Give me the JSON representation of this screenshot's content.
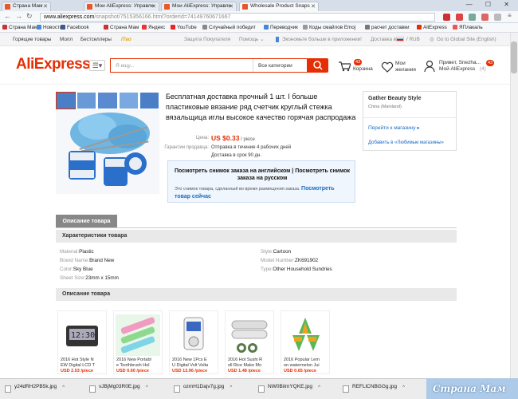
{
  "browser": {
    "tabs": [
      {
        "label": "Страна Мам",
        "active": false
      },
      {
        "label": "Мои AliExpress: Управле",
        "active": false
      },
      {
        "label": "Мои AliExpress: Управле",
        "active": false
      },
      {
        "label": "Wholesale Product Snaps",
        "active": true
      }
    ],
    "url_host": "www.aliexpress.com",
    "url_path": "/snapshot/7515356166.html?orderId=74149760671667",
    "bookmarks": [
      "Страна Мам",
      "Новости",
      "Facebook",
      "Страна Мам",
      "Яндекс",
      "YouTube",
      "Случайный победит",
      "Переводчик",
      "Коды смайлов Emoj",
      "расчет доставки",
      "AliExpress",
      "ЯПлакаль"
    ],
    "window_controls": "— ☐ ✕"
  },
  "topnav": {
    "hot_items": "Горящие товары",
    "mall": "Молл",
    "bestsellers": "Бестселлеры",
    "itao": "iTao",
    "protection": "Защита Покупателя",
    "help": "Помощь ⌄",
    "app": "Экономьте больше в приложении!",
    "delivery": "Доставка в",
    "currency": "/ RUB",
    "global": "Go to Global Site (English)"
  },
  "header": {
    "logo_main": "AliExpress",
    "search_placeholder": "Я ищу...",
    "category": "Все категории",
    "cart_label": "Корзина",
    "cart_count": "43",
    "wish_line1": "Мои",
    "wish_line2": "желания",
    "greeting": "Привет, Snezha...",
    "account": "Мой AliExpress",
    "account_count": "(4)",
    "msg_count": "43"
  },
  "product": {
    "title": "Бесплатная доставка прочный 1 шт. I больше пластиковые вязание ряд счетчик круглый стежка вязальщица иглы высокое качество горячая распродажа",
    "price_label": "Цена:",
    "price": "US $0.33",
    "price_unit": "/ piece",
    "guarantee_label": "Гарантии продавца:",
    "guarantee_1": "Отправка в течение 4 рабочих дней",
    "guarantee_2": "Доставка в срок 90 дн."
  },
  "snapshot": {
    "line1": "Посмотреть снимок заказа на английском | Посмотреть снимок заказа на русском",
    "note": "Это снимок товара, сделанный во время размещения заказа.",
    "link": "Посмотреть товар сейчас"
  },
  "store": {
    "name": "Gather Beauty Style",
    "country": "China (Mainland)",
    "goto": "Перейти к магазину ▸",
    "favorite": "Добавить в «Любимые магазины»"
  },
  "description": {
    "tab": "Описание товара",
    "specs_title": "Характеристики товара",
    "desc_title": "Описание товара",
    "attrs": [
      {
        "k": "Material:",
        "v": "Plastic"
      },
      {
        "k": "Style:",
        "v": "Cartoon"
      },
      {
        "k": "Brand Name:",
        "v": "Brand New"
      },
      {
        "k": "Model Number:",
        "v": "ZK691902"
      },
      {
        "k": "Color:",
        "v": "Sky Blue"
      },
      {
        "k": "Type:",
        "v": "Other Household Sundries"
      },
      {
        "k": "Sheet Size:",
        "v": "23mm x 15mm"
      }
    ]
  },
  "related": [
    {
      "line1": "2016 Hot Style N",
      "line2": "EW Digital LCD T",
      "price": "USD 2.53 /piece",
      "color": "#3a3a3a"
    },
    {
      "line1": "2016 New Portabl",
      "line2": "e Toothbrush Hol",
      "price": "USD 0.60 /piece",
      "color": "#7ad07a"
    },
    {
      "line1": "2016 New 1Pcs E",
      "line2": "U Digital Volt Volta",
      "price": "USD 13.96 /piece",
      "color": "#4a6fbf"
    },
    {
      "line1": "2016 Hot Sushi R",
      "line2": "oll Rice Make Mo",
      "price": "USD 1.48 /piece",
      "color": "#c9c9c9"
    },
    {
      "line1": "2016 Popular Lem",
      "line2": "on watermelon Jui",
      "price": "USD 0.65 /piece",
      "color": "#f0a020"
    }
  ],
  "downloads": [
    "y24dRH2PB5k.jpg",
    "vJBjMg03R0E.jpg",
    "ozmH1Dajv7g.jpg",
    "NW0BiImYQKE.jpg",
    "REFLlCNBGGg.jpg"
  ],
  "watermark": "Страна Мам"
}
